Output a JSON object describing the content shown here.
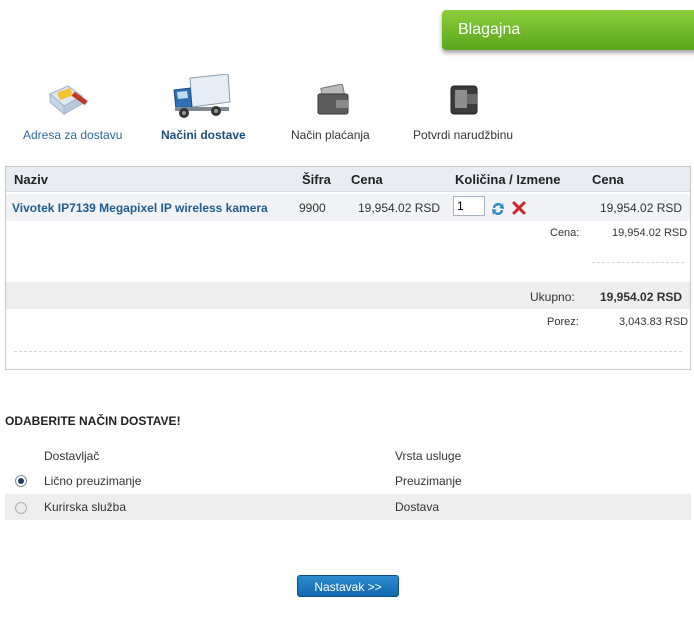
{
  "header": {
    "title": "Blagajna"
  },
  "steps": [
    {
      "label": "Adresa za dostavu",
      "icon": "envelope-pencil-icon"
    },
    {
      "label": "Načini dostave",
      "icon": "delivery-truck-icon"
    },
    {
      "label": "Način plaćanja",
      "icon": "wallet-cards-icon"
    },
    {
      "label": "Potvrdi narudžbinu",
      "icon": "wallet-confirm-icon"
    }
  ],
  "cart": {
    "columns": [
      "Naziv",
      "Šifra",
      "Cena",
      "Količina / Izmene",
      "Cena"
    ],
    "item": {
      "name": "Vivotek IP7139 Megapixel IP wireless kamera",
      "code": "9900",
      "price": "19,954.02 RSD",
      "quantity": "1",
      "line_total": "19,954.02 RSD"
    },
    "subtotal_label": "Cena:",
    "subtotal_value": "19,954.02 RSD",
    "total_label": "Ukupno:",
    "total_value": "19,954.02 RSD",
    "tax_label": "Porez:",
    "tax_value": "3,043.83 RSD"
  },
  "delivery": {
    "title": "ODABERITE NAČIN DOSTAVE!",
    "headers": [
      "Dostavljač",
      "Vrsta usluge"
    ],
    "options": [
      {
        "carrier": "Lično preuzimanje",
        "service": "Preuzimanje",
        "selected": true
      },
      {
        "carrier": "Kurirska služba",
        "service": "Dostava",
        "selected": false
      }
    ]
  },
  "continue_label": "Nastavak >>"
}
